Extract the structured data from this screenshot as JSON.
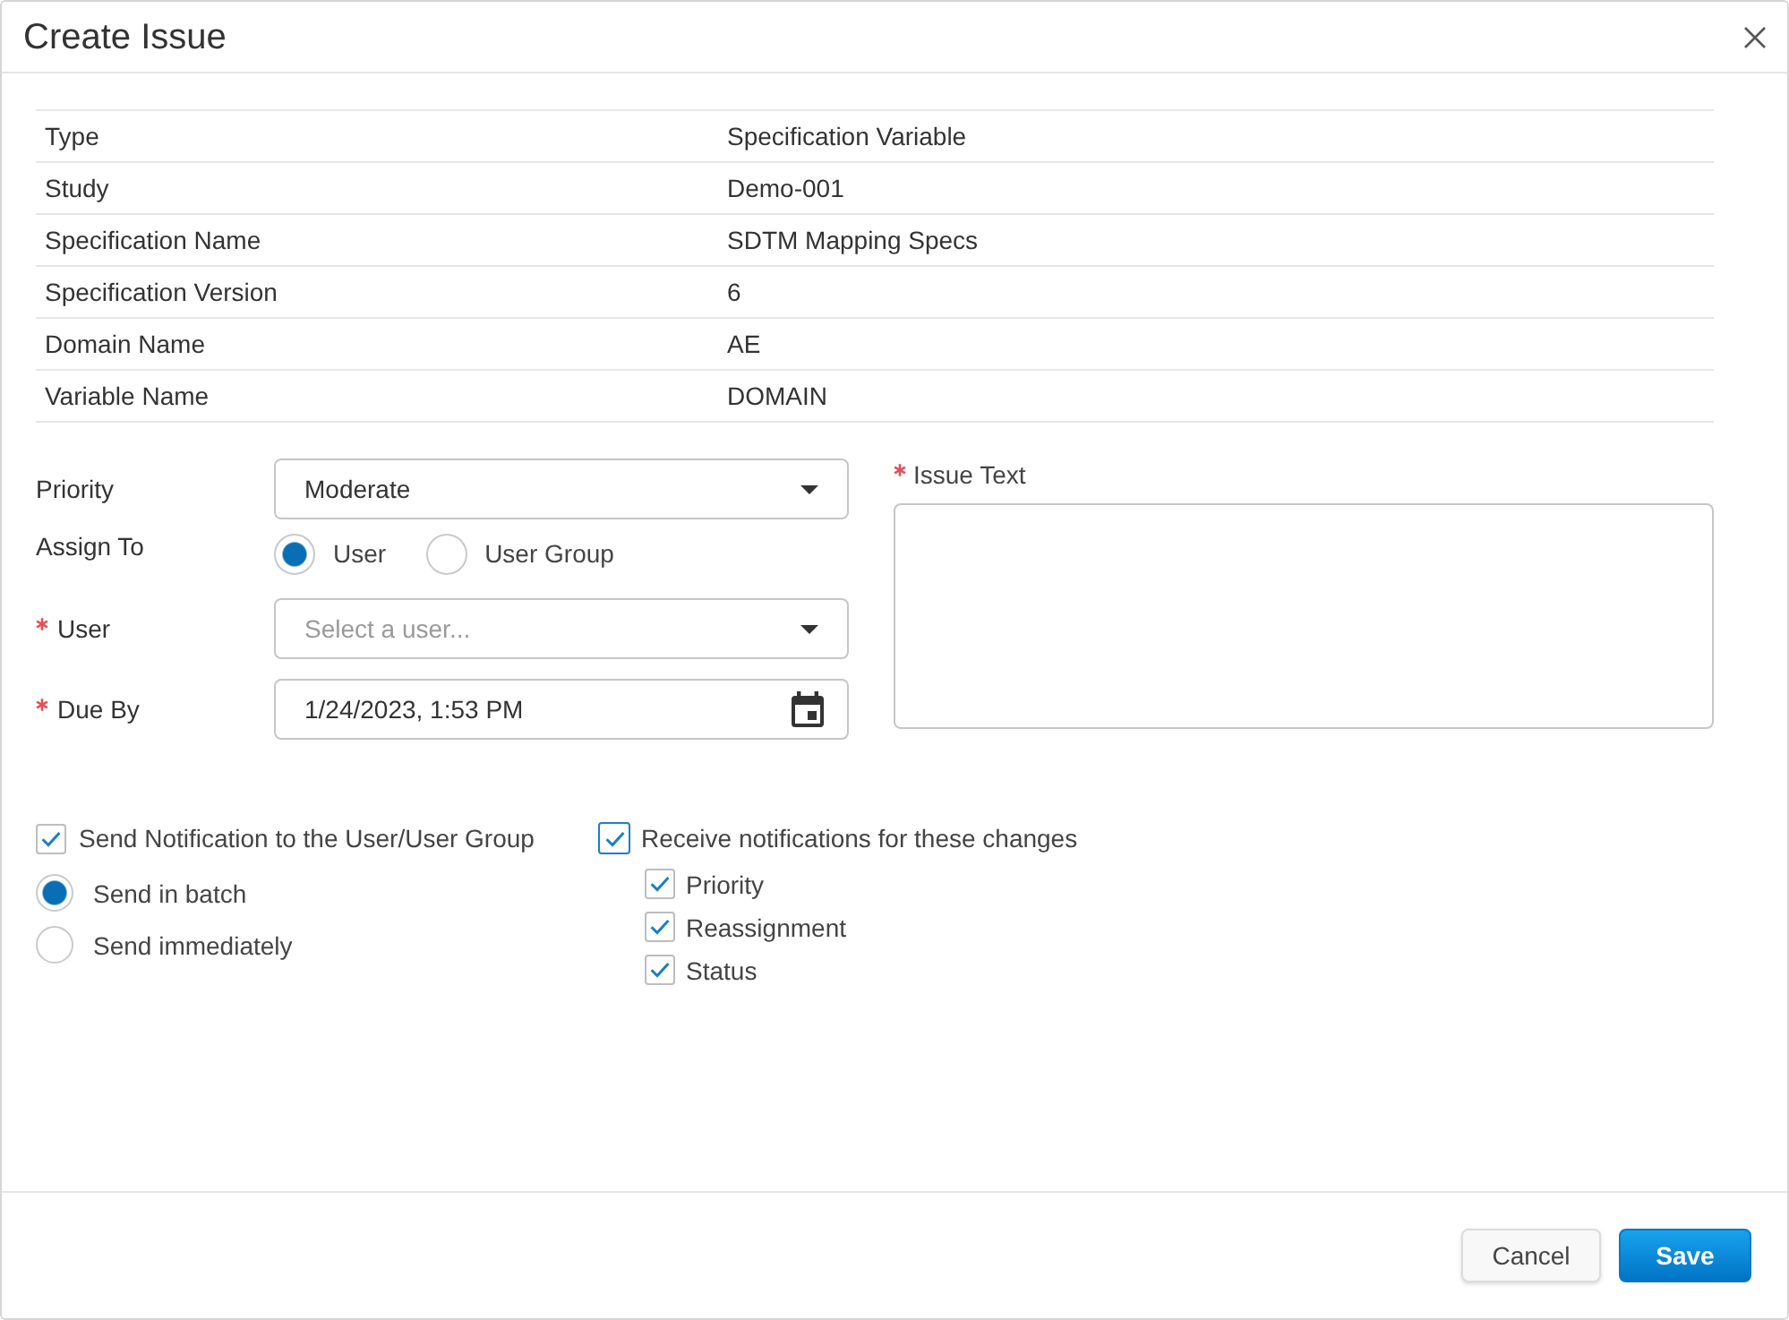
{
  "dialog": {
    "title": "Create Issue"
  },
  "details": [
    {
      "label": "Type",
      "value": "Specification Variable"
    },
    {
      "label": "Study",
      "value": "Demo-001"
    },
    {
      "label": "Specification Name",
      "value": "SDTM Mapping Specs"
    },
    {
      "label": "Specification Version",
      "value": "6"
    },
    {
      "label": "Domain Name",
      "value": "AE"
    },
    {
      "label": "Variable Name",
      "value": "DOMAIN"
    }
  ],
  "fields": [
    {
      "kind": "select",
      "label": "Priority",
      "required": false,
      "value": "Moderate"
    },
    {
      "kind": "radio",
      "label": "Assign To",
      "required": false,
      "options": [
        {
          "label": "User",
          "selected": true
        },
        {
          "label": "User Group",
          "selected": false
        }
      ]
    },
    {
      "kind": "select",
      "label": "User",
      "required": true,
      "placeholder": "Select a user..."
    },
    {
      "kind": "date",
      "label": "Due By",
      "required": true,
      "value": "1/24/2023, 1:53 PM"
    }
  ],
  "issue_text": {
    "label": "Issue Text",
    "required": true
  },
  "send_notification": {
    "label": "Send Notification to the User/User Group",
    "checked": true,
    "options": [
      {
        "label": "Send in batch",
        "selected": true
      },
      {
        "label": "Send immediately",
        "selected": false
      }
    ]
  },
  "receive_notifications": {
    "label": "Receive notifications for these changes",
    "checked": true,
    "focused": true,
    "changes": [
      {
        "label": "Priority",
        "checked": true
      },
      {
        "label": "Reassignment",
        "checked": true
      },
      {
        "label": "Status",
        "checked": true
      }
    ]
  },
  "buttons": [
    {
      "label": "Cancel",
      "kind": "secondary"
    },
    {
      "label": "Save",
      "kind": "primary"
    }
  ]
}
